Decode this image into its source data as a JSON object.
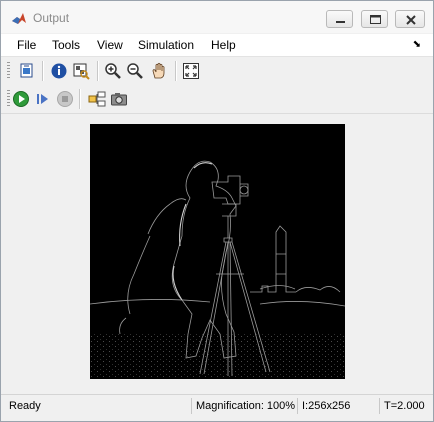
{
  "window": {
    "title": "Output"
  },
  "menu": [
    "File",
    "Tools",
    "View",
    "Simulation",
    "Help"
  ],
  "menu_pin": "⬊",
  "toolbar1": {
    "icons": [
      "print-icon",
      "info-icon",
      "pixel-region-icon",
      "zoom-in-icon",
      "zoom-out-icon",
      "pan-icon",
      "fit-to-window-icon"
    ]
  },
  "toolbar2": {
    "icons": [
      "run-icon",
      "step-forward-icon",
      "stop-icon",
      "highlight-block-icon",
      "snapshot-icon"
    ]
  },
  "image": {
    "description_colors": {
      "background": "#000000",
      "edges": "#bfbfbf"
    }
  },
  "status": {
    "state": "Ready",
    "magnification": "Magnification: 100%",
    "size": "I:256x256",
    "time": "T=2.000"
  }
}
